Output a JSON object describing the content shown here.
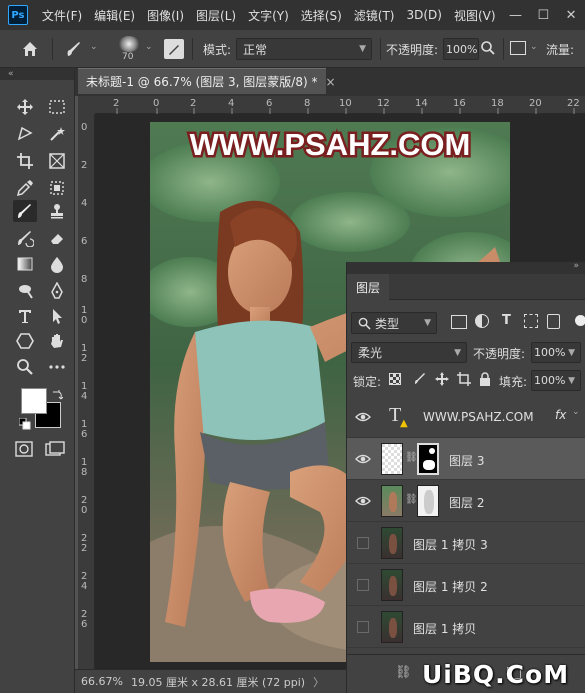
{
  "menubar": {
    "logo": "Ps",
    "items": [
      "文件(F)",
      "编辑(E)",
      "图像(I)",
      "图层(L)",
      "文字(Y)",
      "选择(S)",
      "滤镜(T)",
      "3D(D)",
      "视图(V)"
    ],
    "window_buttons": [
      "—",
      "☐",
      "✕"
    ]
  },
  "options": {
    "brush_size": "70",
    "mode_label": "模式:",
    "mode_value": "正常",
    "opacity_label": "不透明度:",
    "opacity_value": "100%",
    "flow_label": "流量:"
  },
  "document": {
    "tab_title": "未标题-1 @ 66.7% (图层 3, 图层蒙版/8) *",
    "close": "×"
  },
  "ruler": {
    "h": [
      "2",
      "0",
      "2",
      "4",
      "6",
      "8",
      "10",
      "12",
      "14",
      "16",
      "18",
      "20",
      "22",
      "24"
    ],
    "v": [
      "0",
      "2",
      "4",
      "6",
      "8",
      "1\n0",
      "1\n2",
      "1\n4",
      "1\n6",
      "1\n8",
      "2\n0",
      "2\n2",
      "2\n4",
      "2\n6"
    ]
  },
  "canvas_text": "WWW.PSAHZ.COM",
  "status": {
    "zoom": "66.67%",
    "info": "19.05 厘米 x 28.61 厘米 (72 ppi)",
    "arrow": "〉"
  },
  "layers_panel": {
    "tab": "图层",
    "filter_label": "类型",
    "blend_mode": "柔光",
    "opacity_label": "不透明度:",
    "opacity_value": "100%",
    "lock_label": "锁定:",
    "fill_label": "填充:",
    "fill_value": "100%",
    "layers": [
      {
        "name": "WWW.PSAHZ.COM",
        "kind": "text",
        "visible": true,
        "fx": "fx"
      },
      {
        "name": "图层 3",
        "kind": "masked",
        "visible": true,
        "selected": true
      },
      {
        "name": "图层 2",
        "kind": "masked",
        "visible": true
      },
      {
        "name": "图层 1 拷贝 3",
        "kind": "photo",
        "visible": false
      },
      {
        "name": "图层 1 拷贝 2",
        "kind": "photo",
        "visible": false
      },
      {
        "name": "图层 1 拷贝",
        "kind": "photo",
        "visible": false
      }
    ]
  },
  "watermark": "UiBQ.CoM",
  "colors": {
    "accent": "#31a8ff",
    "foreground": "#ffffff",
    "background": "#000000",
    "canvas_text": "#ffffff",
    "canvas_text_stroke": "#7a1f1f"
  }
}
